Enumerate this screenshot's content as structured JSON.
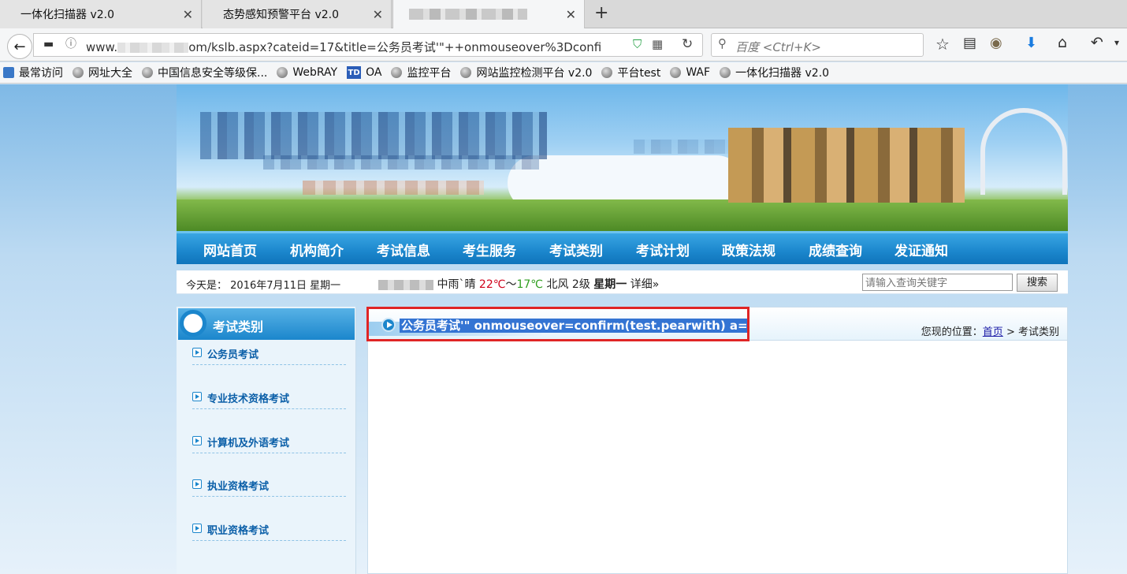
{
  "browser": {
    "tabs": [
      {
        "label": "一体化扫描器 v2.0",
        "active": false
      },
      {
        "label": "态势感知预警平台 v2.0",
        "active": false
      },
      {
        "label": "",
        "active": true
      }
    ],
    "new_tab_icon": "plus-icon",
    "url": {
      "prefix": "www.",
      "suffix": "om/kslb.aspx?cateid=17&title=公务员考试'\"++onmouseover%3Dconfi"
    },
    "search_placeholder": "百度 <Ctrl+K>",
    "bookmarks": [
      {
        "label": "最常访问",
        "icon": "search-bookmark-icon"
      },
      {
        "label": "网址大全",
        "icon": "globe-icon"
      },
      {
        "label": "中国信息安全等级保...",
        "icon": "globe-icon"
      },
      {
        "label": "WebRAY",
        "icon": "globe-icon"
      },
      {
        "label": "OA",
        "icon": "td-icon"
      },
      {
        "label": "监控平台",
        "icon": "globe-icon"
      },
      {
        "label": "网站监控检测平台 v2.0",
        "icon": "globe-icon"
      },
      {
        "label": "平台test",
        "icon": "globe-icon"
      },
      {
        "label": "WAF",
        "icon": "globe-icon"
      },
      {
        "label": "一体化扫描器 v2.0",
        "icon": "globe-icon"
      }
    ]
  },
  "site": {
    "menu": [
      "网站首页",
      "机构简介",
      "考试信息",
      "考生服务",
      "考试类别",
      "考试计划",
      "政策法规",
      "成绩查询",
      "发证通知"
    ],
    "date_label": "今天是：",
    "date_value": "2016年7月11日 星期一",
    "weather": {
      "desc": "中雨`晴",
      "temp_high": "22℃",
      "temp_sep": "～",
      "temp_low": "17℃",
      "wind": "北风",
      "level": "2级",
      "weekday": "星期一",
      "detail": "详细»"
    },
    "search": {
      "placeholder": "请输入查询关键字",
      "button": "搜索"
    },
    "sidebar": {
      "title": "考试类别",
      "items": [
        "公务员考试",
        "专业技术资格考试",
        "计算机及外语考试",
        "执业资格考试",
        "职业资格考试"
      ]
    },
    "content": {
      "title": "公务员考试'\" onmouseover=confirm(test.pearwith) a=",
      "crumb_label": "您现的位置：",
      "crumb_home": "首页",
      "crumb_sep": ">",
      "crumb_current": "考试类别"
    }
  },
  "colors": {
    "accent": "#1b86cc",
    "highlight": "#e02525",
    "selection": "#3474d3"
  }
}
